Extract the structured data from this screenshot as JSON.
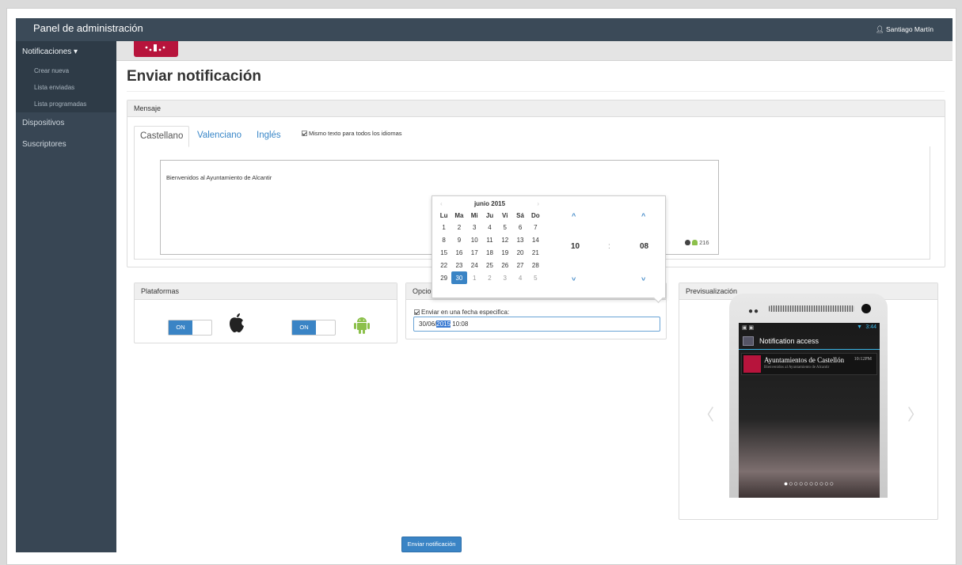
{
  "app": {
    "title": "Panel de administración",
    "user": "Santiago Martín"
  },
  "sidebar": {
    "sections": [
      {
        "label": "Notificaciones",
        "subitems": [
          "Crear nueva",
          "Lista enviadas",
          "Lista programadas"
        ]
      },
      {
        "label": "Dispositivos"
      },
      {
        "label": "Suscriptores"
      }
    ]
  },
  "page": {
    "title": "Enviar notificación"
  },
  "message": {
    "header": "Mensaje",
    "tabs": [
      "Castellano",
      "Valenciano",
      "Inglés"
    ],
    "active_tab": "Castellano",
    "same_text_label": "Mismo texto para todos los idiomas",
    "text": "Bienvenidos al Ayuntamiento de Alcantir",
    "char_count": "216"
  },
  "platforms": {
    "header": "Plataformas",
    "ios_toggle": "ON",
    "android_toggle": "ON"
  },
  "options": {
    "header": "Opcio",
    "date_label": "Enviar en una fecha especifica:",
    "date_prefix": "30/06/",
    "date_selected": "2015",
    "date_suffix": " 10:08"
  },
  "datepicker": {
    "month": "junio 2015",
    "prev": "‹",
    "next": "›",
    "weekdays": [
      "Lu",
      "Ma",
      "Mi",
      "Ju",
      "Vi",
      "Sá",
      "Do"
    ],
    "weeks": [
      [
        "1",
        "2",
        "3",
        "4",
        "5",
        "6",
        "7"
      ],
      [
        "8",
        "9",
        "10",
        "11",
        "12",
        "13",
        "14"
      ],
      [
        "15",
        "16",
        "17",
        "18",
        "19",
        "20",
        "21"
      ],
      [
        "22",
        "23",
        "24",
        "25",
        "26",
        "27",
        "28"
      ],
      [
        "29",
        "30",
        "1",
        "2",
        "3",
        "4",
        "5"
      ]
    ],
    "selected_day": "30",
    "hour": "10",
    "separator": ":",
    "minute": "08"
  },
  "preview": {
    "header": "Previsualización",
    "status_time": "3:44",
    "notif_header": "Notification access",
    "notif_title": "Ayuntamientos de Castellón",
    "notif_time": "10:12PM",
    "notif_body": "Bienvenidos al Ayuntamiento de Alcantir",
    "pager": "●○○○○○○○○○",
    "prev": "〈",
    "next": "〉"
  },
  "actions": {
    "send": "Enviar notificación"
  },
  "colors": {
    "topbar": "#3b4a58",
    "sidebar": "#384654",
    "accent": "#3a84c5",
    "brand": "#b7143c",
    "android": "#8cc04b"
  }
}
